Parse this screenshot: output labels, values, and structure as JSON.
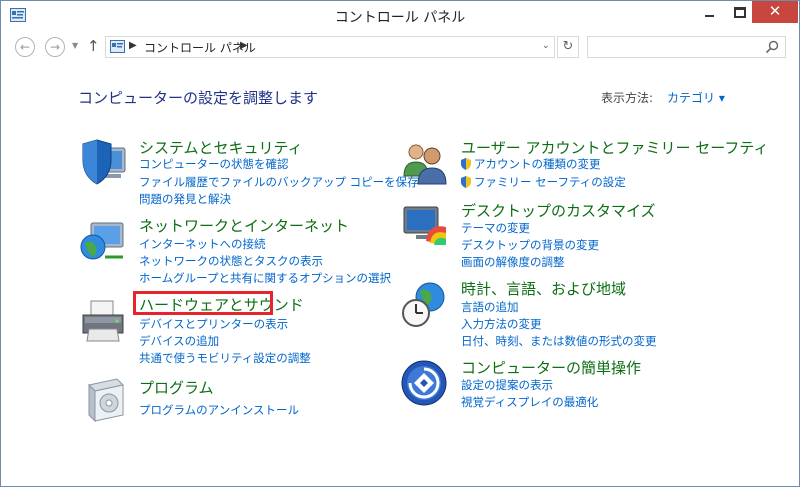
{
  "window": {
    "title": "コントロール パネル",
    "close_glyph": "✕"
  },
  "nav": {
    "back_glyph": "←",
    "forward_glyph": "→",
    "dropdown_glyph": "▼",
    "up_glyph": "↑",
    "refresh_glyph": "↻"
  },
  "address": {
    "separator": "▶",
    "path": "コントロール パネル",
    "dropdown_glyph": "⌄"
  },
  "search": {
    "placeholder": ""
  },
  "header": {
    "title": "コンピューターの設定を調整します",
    "view_label": "表示方法:",
    "view_value": "カテゴリ ▾"
  },
  "categories": [
    {
      "icon": "shield-computer-icon",
      "title": "システムとセキュリティ",
      "links": [
        "コンピューターの状態を確認",
        "ファイル履歴でファイルのバックアップ コピーを保存",
        "問題の発見と解決"
      ]
    },
    {
      "icon": "network-globe-icon",
      "title": "ネットワークとインターネット",
      "links": [
        "インターネットへの接続",
        "ネットワークの状態とタスクの表示",
        "ホームグループと共有に関するオプションの選択"
      ]
    },
    {
      "icon": "printer-icon",
      "title": "ハードウェアとサウンド",
      "links": [
        "デバイスとプリンターの表示",
        "デバイスの追加",
        "共通で使うモビリティ設定の調整"
      ]
    },
    {
      "icon": "program-box-icon",
      "title": "プログラム",
      "links": [
        "プログラムのアンインストール"
      ]
    },
    {
      "icon": "users-icon",
      "title": "ユーザー アカウントとファミリー セーフティ",
      "links": [
        "アカウントの種類の変更",
        "ファミリー セーフティの設定"
      ]
    },
    {
      "icon": "desktop-paint-icon",
      "title": "デスクトップのカスタマイズ",
      "links": [
        "テーマの変更",
        "デスクトップの背景の変更",
        "画面の解像度の調整"
      ]
    },
    {
      "icon": "clock-globe-icon",
      "title": "時計、言語、および地域",
      "links": [
        "言語の追加",
        "入力方法の変更",
        "日付、時刻、または数値の形式の変更"
      ]
    },
    {
      "icon": "ease-of-access-icon",
      "title": "コンピューターの簡単操作",
      "links": [
        "設定の提案の表示",
        "視覚ディスプレイの最適化"
      ]
    }
  ],
  "colors": {
    "title_text": "#1e3287",
    "category_title": "#0d6e14",
    "link": "#0066cc",
    "highlight_box": "#e8232c",
    "close_button": "#c7463d"
  }
}
